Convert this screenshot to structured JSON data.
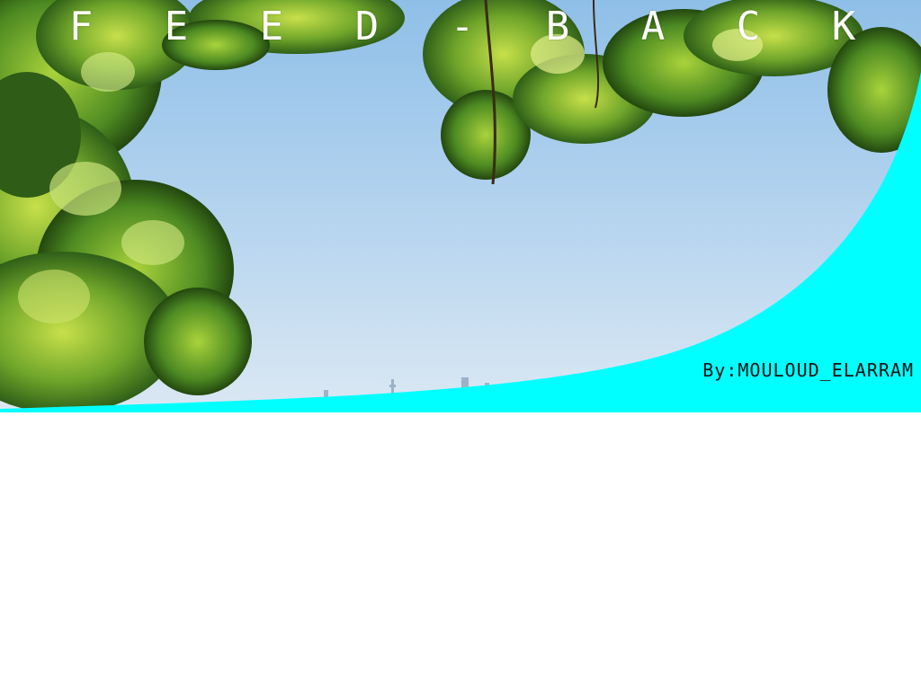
{
  "hero": {
    "title_letters": [
      "F",
      "E",
      "E",
      "D",
      "-",
      "B",
      "A",
      "C",
      "K"
    ],
    "author": "By:MOULOUD_ELARRAM",
    "accent_color": "#00FFFF",
    "image_description_icon": "landscape-photo-icon"
  }
}
